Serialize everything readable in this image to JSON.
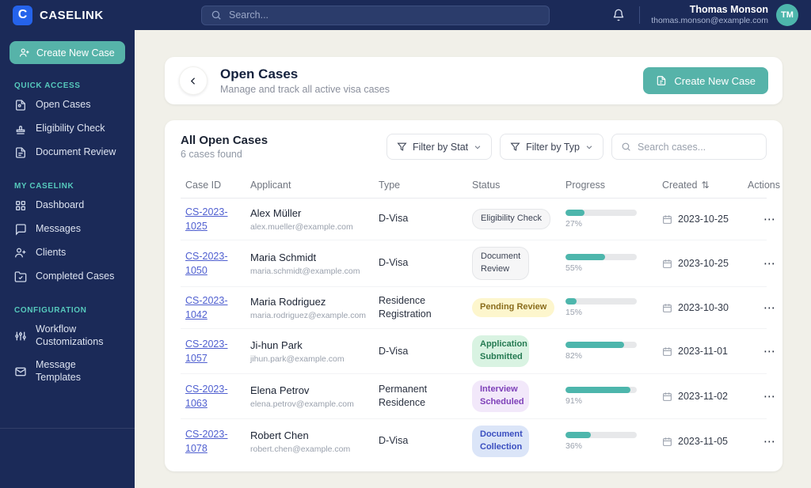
{
  "brand": {
    "logo_letter": "C",
    "name": "CASELINK"
  },
  "topbar": {
    "search_placeholder": "Search...",
    "user": {
      "name": "Thomas Monson",
      "email": "thomas.monson@example.com",
      "initials": "TM"
    }
  },
  "sidebar": {
    "create_button_label": "Create New Case",
    "sections": [
      {
        "title": "QUICK ACCESS",
        "items": [
          {
            "label": "Open Cases"
          },
          {
            "label": "Eligibility Check"
          },
          {
            "label": "Document Review"
          }
        ]
      },
      {
        "title": "MY CASELINK",
        "items": [
          {
            "label": "Dashboard"
          },
          {
            "label": "Messages"
          },
          {
            "label": "Clients"
          },
          {
            "label": "Completed Cases"
          }
        ]
      },
      {
        "title": "CONFIGURATION",
        "items": [
          {
            "label": "Workflow Customizations"
          },
          {
            "label": "Message Templates"
          }
        ]
      }
    ]
  },
  "header": {
    "title": "Open Cases",
    "subtitle": "Manage and track all active visa cases",
    "create_button_label": "Create New Case"
  },
  "table_card": {
    "title": "All Open Cases",
    "count_text": "6 cases found",
    "filters": {
      "status_label": "Filter by Stat",
      "type_label": "Filter by Typ",
      "search_placeholder": "Search cases..."
    },
    "columns": {
      "case_id": "Case ID",
      "applicant": "Applicant",
      "type": "Type",
      "status": "Status",
      "progress": "Progress",
      "created": "Created",
      "actions": "Actions"
    },
    "rows": [
      {
        "case_id": "CS-2023-1025",
        "name": "Alex Müller",
        "email": "alex.mueller@example.com",
        "type": "D-Visa",
        "status": "Eligibility Check",
        "status_class": "badge-gray",
        "progress": 27,
        "progress_label": "27%",
        "created": "2023-10-25"
      },
      {
        "case_id": "CS-2023-1050",
        "name": "Maria Schmidt",
        "email": "maria.schmidt@example.com",
        "type": "D-Visa",
        "status": "Document Review",
        "status_class": "badge-gray badge-wrap",
        "progress": 55,
        "progress_label": "55%",
        "created": "2023-10-25"
      },
      {
        "case_id": "CS-2023-1042",
        "name": "Maria Rodriguez",
        "email": "maria.rodriguez@example.com",
        "type": "Residence Registration",
        "status": "Pending Review",
        "status_class": "badge-yellow",
        "progress": 15,
        "progress_label": "15%",
        "created": "2023-10-30"
      },
      {
        "case_id": "CS-2023-1057",
        "name": "Ji-hun Park",
        "email": "jihun.park@example.com",
        "type": "D-Visa",
        "status": "Application Submitted",
        "status_class": "badge-green badge-wrap",
        "progress": 82,
        "progress_label": "82%",
        "created": "2023-11-01"
      },
      {
        "case_id": "CS-2023-1063",
        "name": "Elena Petrov",
        "email": "elena.petrov@example.com",
        "type": "Permanent Residence",
        "status": "Interview Scheduled",
        "status_class": "badge-purple badge-wrap",
        "progress": 91,
        "progress_label": "91%",
        "created": "2023-11-02"
      },
      {
        "case_id": "CS-2023-1078",
        "name": "Robert Chen",
        "email": "robert.chen@example.com",
        "type": "D-Visa",
        "status": "Document Collection",
        "status_class": "badge-blue badge-wrap",
        "progress": 36,
        "progress_label": "36%",
        "created": "2023-11-05"
      }
    ]
  },
  "icons": {
    "sort_glyph": "⇅",
    "ellipsis_glyph": "⋯"
  },
  "colors": {
    "navy": "#1b2a58",
    "accent_teal": "#56b3a9",
    "logo_blue": "#2563eb",
    "link_blue": "#4f5fd0",
    "progress_teal": "#4db6ac",
    "main_bg": "#f1f0e9"
  }
}
